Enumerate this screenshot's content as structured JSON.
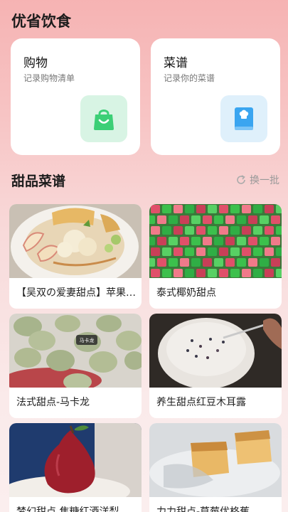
{
  "header": {
    "title": "优省饮食"
  },
  "cards": [
    {
      "title": "购物",
      "subtitle": "记录购物清单",
      "icon": "shopping-bag-icon",
      "color": "#3ccf76"
    },
    {
      "title": "菜谱",
      "subtitle": "记录你的菜谱",
      "icon": "recipe-book-icon",
      "color": "#3aa5f0"
    }
  ],
  "section": {
    "title": "甜品菜谱",
    "refresh_label": "换一批",
    "refresh_icon": "refresh-icon"
  },
  "recipes": [
    {
      "title": "【吴双の爱妻甜点】苹果沙拉"
    },
    {
      "title": "泰式椰奶甜点"
    },
    {
      "title": "法式甜点-马卡龙",
      "photo_tag": "马卡龙"
    },
    {
      "title": "养生甜点红豆木耳露"
    },
    {
      "title": "梦幻甜点 焦糖红酒洋梨"
    },
    {
      "title": "力力甜点-草莓优格蕉"
    }
  ]
}
